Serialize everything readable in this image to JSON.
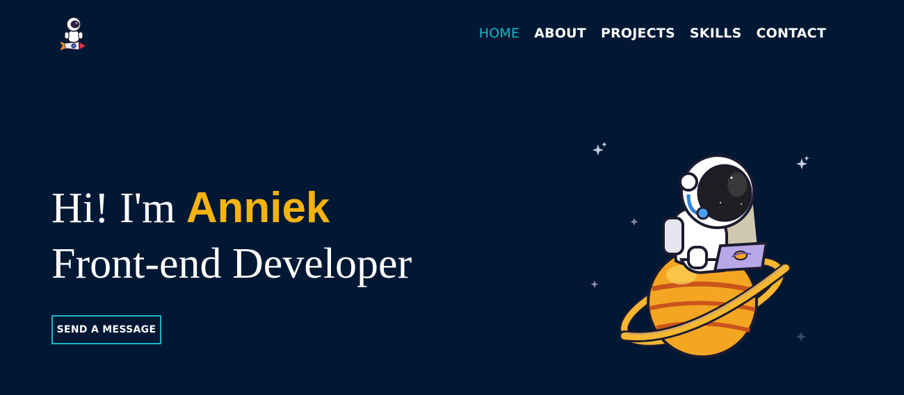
{
  "nav": {
    "items": [
      {
        "label": "HOME",
        "active": true
      },
      {
        "label": "ABOUT",
        "active": false
      },
      {
        "label": "PROJECTS",
        "active": false
      },
      {
        "label": "SKILLS",
        "active": false
      },
      {
        "label": "CONTACT",
        "active": false
      }
    ]
  },
  "hero": {
    "greeting": "Hi! I'm",
    "name": "Anniek",
    "role": "Front-end Developer",
    "cta_label": "SEND A MESSAGE"
  },
  "colors": {
    "background": "#001833",
    "accent": "#17b8c9",
    "name_highlight": "#f5b312"
  },
  "icons": {
    "logo": "astronaut-on-rocket-logo",
    "illustration": "astronaut-on-planet-with-laptop"
  }
}
